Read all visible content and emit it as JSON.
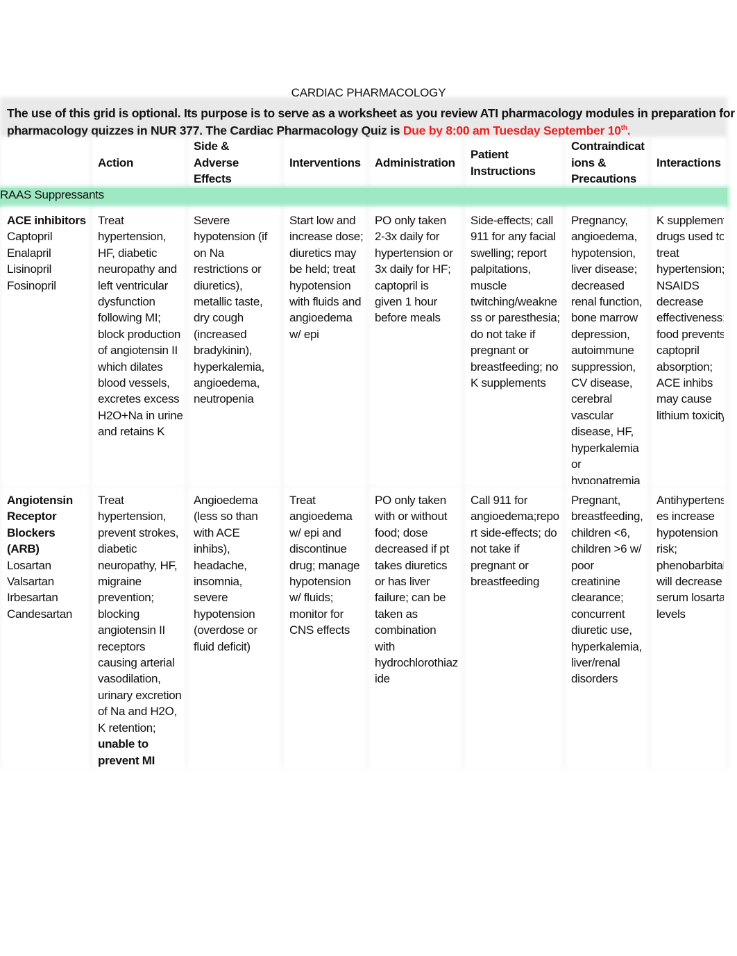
{
  "document": {
    "title": "CARDIAC PHARMACOLOGY",
    "intro": {
      "text_before_due": "The use of this grid is optional. Its purpose is to serve as a worksheet as you review ATI pharmacology modules in preparation for",
      "text_line2": "pharmacology quizzes in NUR 377. The Cardiac Pharmacology Quiz is",
      "due_text": "Due by 8:00 am Tuesday September 10",
      "due_superscript": "th",
      "due_suffix": ".",
      "due_color": "#ee1c1c"
    }
  },
  "table": {
    "headers": [
      [
        ""
      ],
      [
        "Action"
      ],
      [
        "Side & Adverse",
        "Effects"
      ],
      [
        "Interventions"
      ],
      [
        "Administration"
      ],
      [
        "Patient",
        "Instructions"
      ],
      [
        "Contraindicat",
        "ions &",
        "Precautions"
      ],
      [
        "Interactions"
      ]
    ],
    "section": {
      "label": "RAAS Suppressants",
      "color": "#9ee8c4"
    },
    "rows": [
      {
        "class_lines": [
          "ACE inhibitors"
        ],
        "drugs": [
          "Captopril",
          "Enalapril",
          "Lisinopril",
          "Fosinopril"
        ],
        "action": [
          "Treat",
          "hypertension,",
          "HF, diabetic",
          "neuropathy and",
          "left ventricular",
          "dysfunction",
          "following MI;",
          "block production",
          "of angiotensin II",
          "which dilates",
          "blood vessels,",
          "excretes excess",
          "H2O+Na in urine",
          "and retains K"
        ],
        "action_bold": [],
        "side_effects": [
          "Severe",
          "hypotension (if",
          "on Na",
          "restrictions or",
          "diuretics),",
          "metallic taste,",
          "dry cough",
          "(increased",
          "bradykinin),",
          "hyperkalemia,",
          "angioedema,",
          "neutropenia"
        ],
        "interventions": [
          "Start low and",
          "increase dose;",
          "diuretics may",
          "be held; treat",
          "hypotension",
          "with fluids and",
          "angioedema",
          "w/ epi"
        ],
        "administration": [
          "PO only taken",
          "2-3x daily for",
          "hypertension or",
          "3x daily for HF;",
          "captopril is",
          "given 1 hour",
          "before meals"
        ],
        "patient_instructions": [
          "Side-effects; call",
          "911 for any facial",
          "swelling; report",
          "palpitations,",
          "muscle",
          "twitching/weakne",
          "ss or paresthesia;",
          "do not take if",
          "pregnant or",
          "breastfeeding; no",
          "K supplements"
        ],
        "contraindications": [
          "Pregnancy,",
          "angioedema,",
          "hypotension,",
          "liver disease;",
          "decreased",
          "renal function,",
          "bone marrow",
          "depression,",
          "autoimmune",
          "suppression,",
          "CV disease,",
          "cerebral",
          "vascular",
          "disease, HF,",
          "hyperkalemia",
          "or",
          "hyponatremia"
        ],
        "interactions": [
          "K supplements",
          "drugs used to",
          "treat",
          "hypertension;",
          "NSAIDS",
          "decrease",
          "effectiveness;",
          "food prevents",
          "captopril",
          "absorption;",
          "ACE inhibs",
          "may cause",
          "lithium toxicity"
        ]
      },
      {
        "class_lines": [
          "Angiotensin",
          "Receptor",
          "Blockers",
          "(ARB)"
        ],
        "drugs": [
          "Losartan",
          "Valsartan",
          "Irbesartan",
          "Candesartan"
        ],
        "action": [
          "Treat",
          "hypertension,",
          "prevent strokes,",
          "diabetic",
          "neuropathy, HF,",
          "migraine",
          "prevention;",
          "blocking",
          "angiotensin II",
          "receptors",
          "causing arterial",
          "vasodilation,",
          "urinary excretion",
          "of Na and H2O,",
          "K retention;"
        ],
        "action_bold": [
          "unable to",
          "prevent MI"
        ],
        "side_effects": [
          "Angioedema",
          "(less so than",
          "with ACE",
          "inhibs),",
          "headache,",
          "insomnia,",
          "severe",
          "hypotension",
          "(overdose or",
          "fluid deficit)"
        ],
        "interventions": [
          "Treat",
          "angioedema",
          "w/ epi and",
          "discontinue",
          "drug; manage",
          "hypotension",
          "w/ fluids;",
          "monitor for",
          "CNS effects"
        ],
        "administration": [
          "PO only taken",
          "with or without",
          "food; dose",
          "decreased if pt",
          "takes diuretics",
          "or has liver",
          "failure; can be",
          "taken as",
          "combination",
          "with",
          "hydrochlorothiaz",
          "ide"
        ],
        "patient_instructions": [
          "Call 911 for",
          "angioedema;repo",
          "rt side-effects; do",
          "not take if",
          "pregnant or",
          "breastfeeding"
        ],
        "contraindications": [
          "Pregnant,",
          "breastfeeding,",
          "children <6,",
          "children >6 w/",
          "poor",
          "creatinine",
          "clearance;",
          "concurrent",
          "diuretic use,",
          "hyperkalemia,",
          "liver/renal",
          "disorders"
        ],
        "interactions": [
          "Antihypertensiv",
          "es increase",
          "hypotension",
          "risk;",
          "phenobarbital",
          "will decrease",
          "serum losartan",
          "levels"
        ]
      }
    ]
  }
}
